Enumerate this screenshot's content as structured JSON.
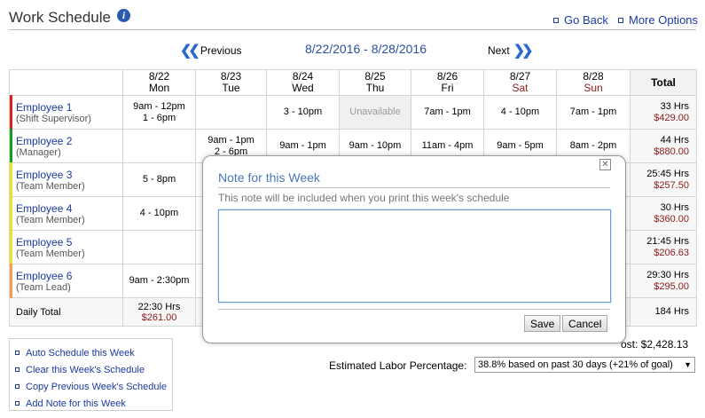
{
  "header": {
    "title": "Work Schedule",
    "go_back": "Go Back",
    "more_options": "More Options"
  },
  "week": {
    "range": "8/22/2016 - 8/28/2016",
    "previous": "Previous",
    "next": "Next"
  },
  "days": [
    {
      "date": "8/22",
      "name": "Mon"
    },
    {
      "date": "8/23",
      "name": "Tue"
    },
    {
      "date": "8/24",
      "name": "Wed"
    },
    {
      "date": "8/25",
      "name": "Thu"
    },
    {
      "date": "8/26",
      "name": "Fri"
    },
    {
      "date": "8/27",
      "name": "Sat"
    },
    {
      "date": "8/28",
      "name": "Sun"
    }
  ],
  "total_header": "Total",
  "employees": [
    {
      "name": "Employee 1",
      "role": "(Shift Supervisor)",
      "color": "#e02020",
      "shifts": [
        "9am - 12pm\n1 - 6pm",
        "",
        "3 - 10pm",
        "Unavailable",
        "7am - 1pm",
        "4 - 10pm",
        "7am - 1pm"
      ],
      "hours": "33 Hrs",
      "cost": "$429.00"
    },
    {
      "name": "Employee 2",
      "role": "(Manager)",
      "color": "#1a9a2a",
      "shifts": [
        "",
        "9am - 1pm\n2 - 6pm",
        "9am - 1pm",
        "9am - 10pm",
        "11am - 4pm",
        "9am - 5pm",
        "8am - 2pm"
      ],
      "hours": "44 Hrs",
      "cost": "$880.00"
    },
    {
      "name": "Employee 3",
      "role": "(Team Member)",
      "color": "#f0e020",
      "shifts": [
        "5 - 8pm",
        "",
        "",
        "",
        "",
        "",
        ""
      ],
      "hours": "25:45 Hrs",
      "cost": "$257.50"
    },
    {
      "name": "Employee 4",
      "role": "(Team Member)",
      "color": "#f0e020",
      "shifts": [
        "4 - 10pm",
        "",
        "",
        "",
        "",
        "",
        ""
      ],
      "hours": "30 Hrs",
      "cost": "$360.00"
    },
    {
      "name": "Employee 5",
      "role": "(Team Member)",
      "color": "#f0e020",
      "shifts": [
        "",
        "",
        "",
        "",
        "",
        "",
        ""
      ],
      "hours": "21:45 Hrs",
      "cost": "$206.63"
    },
    {
      "name": "Employee 6",
      "role": "(Team Lead)",
      "color": "#f0a050",
      "shifts": [
        "9am - 2:30pm",
        "",
        "",
        "",
        "",
        "",
        ""
      ],
      "hours": "29:30 Hrs",
      "cost": "$295.00"
    }
  ],
  "daily_total": {
    "label": "Daily Total",
    "mon_hours": "22:30 Hrs",
    "mon_cost": "$261.00",
    "total": "184 Hrs"
  },
  "actions": [
    "Auto Schedule this Week",
    "Clear this Week's Schedule",
    "Copy Previous Week's Schedule",
    "Add Note for this Week"
  ],
  "cost_label": "ost:",
  "cost_value": "$2,428.13",
  "labor": {
    "label": "Estimated Labor Percentage:",
    "value": "38.8% based on past 30 days (+21% of goal)"
  },
  "modal": {
    "title": "Note for this Week",
    "description": "This note will be included when you print this week's schedule",
    "note_value": "",
    "save": "Save",
    "cancel": "Cancel",
    "close": "X"
  }
}
